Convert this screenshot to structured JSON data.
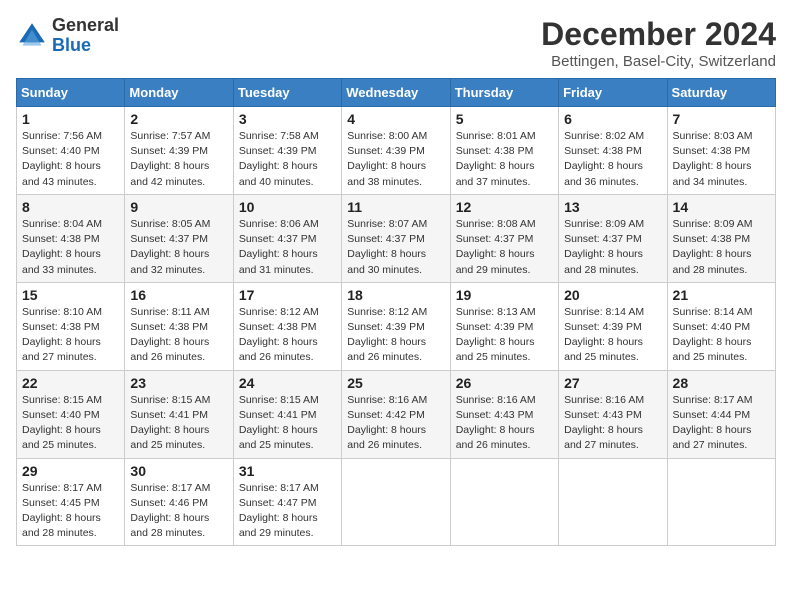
{
  "logo": {
    "general": "General",
    "blue": "Blue"
  },
  "header": {
    "title": "December 2024",
    "subtitle": "Bettingen, Basel-City, Switzerland"
  },
  "weekdays": [
    "Sunday",
    "Monday",
    "Tuesday",
    "Wednesday",
    "Thursday",
    "Friday",
    "Saturday"
  ],
  "weeks": [
    [
      {
        "day": "1",
        "sunrise": "7:56 AM",
        "sunset": "4:40 PM",
        "daylight": "8 hours and 43 minutes."
      },
      {
        "day": "2",
        "sunrise": "7:57 AM",
        "sunset": "4:39 PM",
        "daylight": "8 hours and 42 minutes."
      },
      {
        "day": "3",
        "sunrise": "7:58 AM",
        "sunset": "4:39 PM",
        "daylight": "8 hours and 40 minutes."
      },
      {
        "day": "4",
        "sunrise": "8:00 AM",
        "sunset": "4:39 PM",
        "daylight": "8 hours and 38 minutes."
      },
      {
        "day": "5",
        "sunrise": "8:01 AM",
        "sunset": "4:38 PM",
        "daylight": "8 hours and 37 minutes."
      },
      {
        "day": "6",
        "sunrise": "8:02 AM",
        "sunset": "4:38 PM",
        "daylight": "8 hours and 36 minutes."
      },
      {
        "day": "7",
        "sunrise": "8:03 AM",
        "sunset": "4:38 PM",
        "daylight": "8 hours and 34 minutes."
      }
    ],
    [
      {
        "day": "8",
        "sunrise": "8:04 AM",
        "sunset": "4:38 PM",
        "daylight": "8 hours and 33 minutes."
      },
      {
        "day": "9",
        "sunrise": "8:05 AM",
        "sunset": "4:37 PM",
        "daylight": "8 hours and 32 minutes."
      },
      {
        "day": "10",
        "sunrise": "8:06 AM",
        "sunset": "4:37 PM",
        "daylight": "8 hours and 31 minutes."
      },
      {
        "day": "11",
        "sunrise": "8:07 AM",
        "sunset": "4:37 PM",
        "daylight": "8 hours and 30 minutes."
      },
      {
        "day": "12",
        "sunrise": "8:08 AM",
        "sunset": "4:37 PM",
        "daylight": "8 hours and 29 minutes."
      },
      {
        "day": "13",
        "sunrise": "8:09 AM",
        "sunset": "4:37 PM",
        "daylight": "8 hours and 28 minutes."
      },
      {
        "day": "14",
        "sunrise": "8:09 AM",
        "sunset": "4:38 PM",
        "daylight": "8 hours and 28 minutes."
      }
    ],
    [
      {
        "day": "15",
        "sunrise": "8:10 AM",
        "sunset": "4:38 PM",
        "daylight": "8 hours and 27 minutes."
      },
      {
        "day": "16",
        "sunrise": "8:11 AM",
        "sunset": "4:38 PM",
        "daylight": "8 hours and 26 minutes."
      },
      {
        "day": "17",
        "sunrise": "8:12 AM",
        "sunset": "4:38 PM",
        "daylight": "8 hours and 26 minutes."
      },
      {
        "day": "18",
        "sunrise": "8:12 AM",
        "sunset": "4:39 PM",
        "daylight": "8 hours and 26 minutes."
      },
      {
        "day": "19",
        "sunrise": "8:13 AM",
        "sunset": "4:39 PM",
        "daylight": "8 hours and 25 minutes."
      },
      {
        "day": "20",
        "sunrise": "8:14 AM",
        "sunset": "4:39 PM",
        "daylight": "8 hours and 25 minutes."
      },
      {
        "day": "21",
        "sunrise": "8:14 AM",
        "sunset": "4:40 PM",
        "daylight": "8 hours and 25 minutes."
      }
    ],
    [
      {
        "day": "22",
        "sunrise": "8:15 AM",
        "sunset": "4:40 PM",
        "daylight": "8 hours and 25 minutes."
      },
      {
        "day": "23",
        "sunrise": "8:15 AM",
        "sunset": "4:41 PM",
        "daylight": "8 hours and 25 minutes."
      },
      {
        "day": "24",
        "sunrise": "8:15 AM",
        "sunset": "4:41 PM",
        "daylight": "8 hours and 25 minutes."
      },
      {
        "day": "25",
        "sunrise": "8:16 AM",
        "sunset": "4:42 PM",
        "daylight": "8 hours and 26 minutes."
      },
      {
        "day": "26",
        "sunrise": "8:16 AM",
        "sunset": "4:43 PM",
        "daylight": "8 hours and 26 minutes."
      },
      {
        "day": "27",
        "sunrise": "8:16 AM",
        "sunset": "4:43 PM",
        "daylight": "8 hours and 27 minutes."
      },
      {
        "day": "28",
        "sunrise": "8:17 AM",
        "sunset": "4:44 PM",
        "daylight": "8 hours and 27 minutes."
      }
    ],
    [
      {
        "day": "29",
        "sunrise": "8:17 AM",
        "sunset": "4:45 PM",
        "daylight": "8 hours and 28 minutes."
      },
      {
        "day": "30",
        "sunrise": "8:17 AM",
        "sunset": "4:46 PM",
        "daylight": "8 hours and 28 minutes."
      },
      {
        "day": "31",
        "sunrise": "8:17 AM",
        "sunset": "4:47 PM",
        "daylight": "8 hours and 29 minutes."
      },
      null,
      null,
      null,
      null
    ]
  ]
}
